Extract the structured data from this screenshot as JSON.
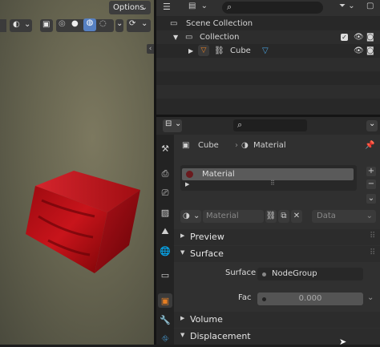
{
  "viewport": {
    "header": {
      "options_label": "Options"
    },
    "cube_color": "#c0121a"
  },
  "outliner": {
    "rows": [
      {
        "label": "Scene Collection"
      },
      {
        "label": "Collection"
      },
      {
        "label": "Cube"
      }
    ]
  },
  "properties": {
    "breadcrumb": {
      "object": "Cube",
      "material": "Material"
    },
    "material_slot": "Material",
    "datablock": {
      "name": "Material",
      "link": "Data"
    },
    "panels": {
      "preview": "Preview",
      "surface": "Surface",
      "volume": "Volume",
      "displacement": "Displacement"
    },
    "surface_field": {
      "label": "Surface",
      "value": "NodeGroup"
    },
    "fac_field": {
      "label": "Fac",
      "value": "0.000"
    }
  },
  "colors": {
    "accent_orange": "#e67e22",
    "icon_blue": "#4aa3df",
    "green_icon": "#8fd24a"
  }
}
